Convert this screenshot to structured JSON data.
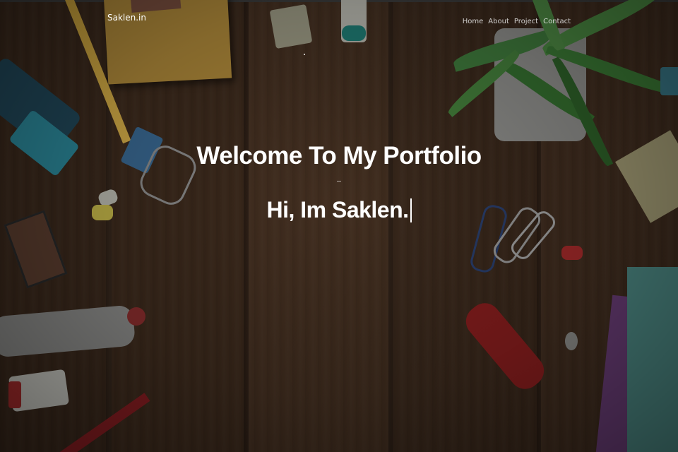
{
  "navbar": {
    "brand": "Saklen.in",
    "links": [
      {
        "label": "Home"
      },
      {
        "label": "About"
      },
      {
        "label": "Project"
      },
      {
        "label": "Contact"
      }
    ]
  },
  "hero": {
    "headline": "Welcome To My Portfolio",
    "typed_text": "Hi, Im Saklen.",
    "background": "wooden desk with stationery, plant, markers and paper clips",
    "overlay_color": "#000000"
  },
  "colors": {
    "text": "#ffffff",
    "nav_text": "#ebebeb"
  }
}
